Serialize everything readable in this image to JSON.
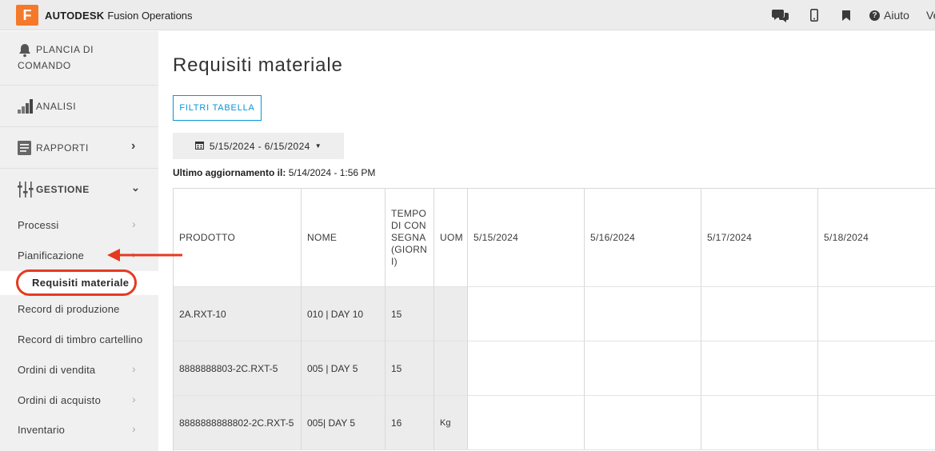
{
  "topbar": {
    "brand_letter": "F",
    "brand_name": "AUTODESK",
    "product_name": "Fusion Operations",
    "help_label": "Aiuto",
    "user_initial": "Ve",
    "icons": [
      "chat-icon",
      "mobile-icon",
      "bookmark-icon",
      "help-icon"
    ]
  },
  "sidebar": {
    "main": [
      {
        "icon": "bell-icon",
        "label": "PLANCIA DI COMANDO"
      },
      {
        "icon": "chart-icon",
        "label": "ANALISI"
      },
      {
        "icon": "report-icon",
        "label": "RAPPORTI"
      },
      {
        "icon": "sliders-icon",
        "label": "GESTIONE"
      }
    ],
    "sub": [
      {
        "label": "Processi"
      },
      {
        "label": "Pianificazione"
      },
      {
        "label": "Requisiti materiale"
      },
      {
        "label": "Record di produzione"
      },
      {
        "label": "Record di timbro cartellino"
      },
      {
        "label": "Ordini di vendita"
      },
      {
        "label": "Ordini di acquisto"
      },
      {
        "label": "Inventario"
      }
    ]
  },
  "main": {
    "title": "Requisiti materiale",
    "filter_button": "FILTRI TABELLA",
    "date_range": "5/15/2024 - 6/15/2024",
    "last_update_label": "Ultimo aggiornamento il:",
    "last_update_value": "5/14/2024 - 1:56 PM"
  },
  "table": {
    "headers": [
      "PRODOTTO",
      "NOME",
      "TEMPO DI CONSEGNA (GIORNI)",
      "UOM",
      "5/15/2024",
      "5/16/2024",
      "5/17/2024",
      "5/18/2024"
    ],
    "rows": [
      [
        "2A.RXT-10",
        "010 | DAY 10",
        "15",
        "",
        "",
        "",
        "",
        ""
      ],
      [
        "8888888803-2C.RXT-5",
        "005 | DAY 5",
        "15",
        "",
        "",
        "",
        "",
        ""
      ],
      [
        "8888888888802-2C.RXT-5",
        "005| DAY 5",
        "16",
        "Kg",
        "",
        "",
        "",
        ""
      ]
    ]
  },
  "colors": {
    "accent": "#0696d7",
    "brand": "#f5792a",
    "annotation": "#e53a20"
  }
}
